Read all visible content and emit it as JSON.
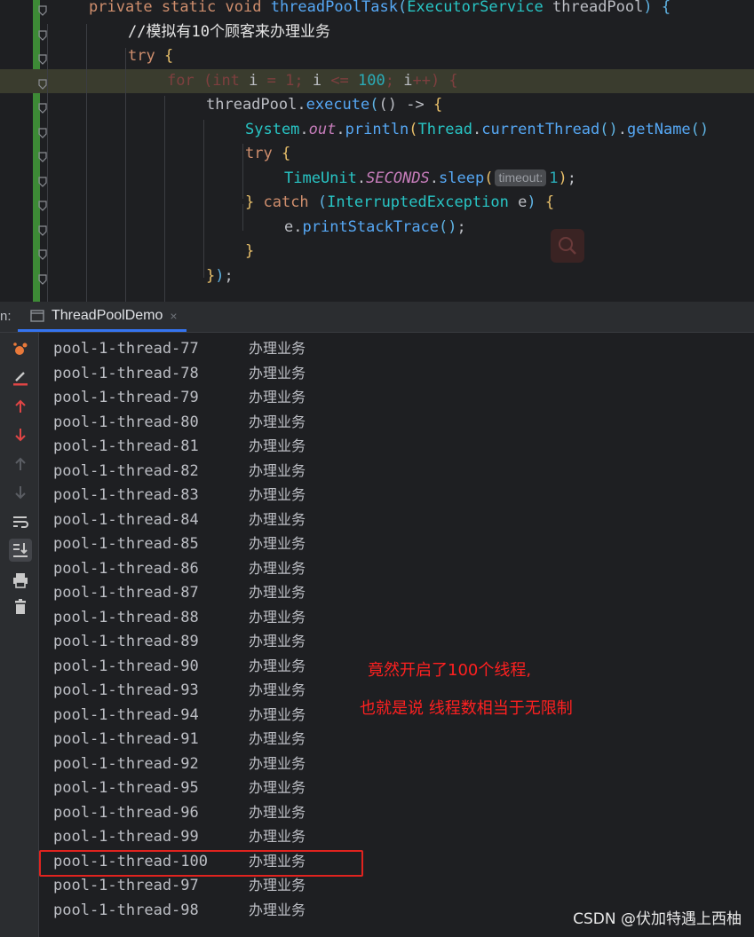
{
  "editor": {
    "lines": [
      {
        "parts": [
          [
            "kw",
            "private static void "
          ],
          [
            "fn",
            "threadPoolTask"
          ],
          [
            "paren2",
            "("
          ],
          [
            "cls",
            "ExecutorService "
          ],
          [
            "pm",
            "threadPool"
          ],
          [
            "paren2",
            ")"
          ],
          [
            "pm",
            " "
          ],
          [
            "paren2",
            "{"
          ]
        ]
      },
      {
        "parts": [
          [
            "cmt",
            "//模拟有10个顾客来办理业务"
          ]
        ]
      },
      {
        "parts": [
          [
            "kw",
            "try "
          ],
          [
            "paren1",
            "{"
          ]
        ]
      },
      {
        "parts": [
          [
            "hidden-kw",
            "for "
          ],
          [
            "hidden-kw",
            "("
          ],
          [
            "hidden-kw",
            "int "
          ],
          [
            "pm",
            "i"
          ],
          [
            "hidden-kw",
            " = 1; "
          ],
          [
            "pm",
            "i"
          ],
          [
            "hidden-kw",
            " <= "
          ],
          [
            "num",
            "100"
          ],
          [
            "hidden-kw",
            "; "
          ],
          [
            "pm",
            "i"
          ],
          [
            "hidden-kw",
            "++) {"
          ]
        ]
      },
      {
        "parts": [
          [
            "pm",
            "threadPool"
          ],
          [
            "pm",
            "."
          ],
          [
            "fn",
            "execute"
          ],
          [
            "paren2",
            "("
          ],
          [
            "pm",
            "() -> "
          ],
          [
            "paren1",
            "{"
          ]
        ]
      },
      {
        "parts": [
          [
            "cls",
            "System"
          ],
          [
            "pm",
            "."
          ],
          [
            "stat",
            "out"
          ],
          [
            "pm",
            "."
          ],
          [
            "fn",
            "println"
          ],
          [
            "paren1",
            "("
          ],
          [
            "cls",
            "Thread"
          ],
          [
            "pm",
            "."
          ],
          [
            "fn",
            "currentThread"
          ],
          [
            "paren2",
            "()"
          ],
          [
            "pm",
            "."
          ],
          [
            "fn",
            "getName"
          ],
          [
            "paren2",
            "()"
          ]
        ]
      },
      {
        "parts": [
          [
            "kw",
            "try "
          ],
          [
            "paren1",
            "{"
          ]
        ]
      },
      {
        "parts": [
          [
            "cls",
            "TimeUnit"
          ],
          [
            "pm",
            "."
          ],
          [
            "stat",
            "SECONDS"
          ],
          [
            "pm",
            "."
          ],
          [
            "fn",
            "sleep"
          ],
          [
            "paren1",
            "("
          ],
          [
            "hint",
            "timeout:"
          ],
          [
            "num",
            "1"
          ],
          [
            "paren1",
            ")"
          ],
          [
            "pm",
            ";"
          ]
        ]
      },
      {
        "parts": [
          [
            "paren1",
            "} "
          ],
          [
            "kw",
            "catch "
          ],
          [
            "paren2",
            "("
          ],
          [
            "cls",
            "InterruptedException "
          ],
          [
            "pm",
            "e"
          ],
          [
            "paren2",
            ")"
          ],
          [
            "pm",
            " "
          ],
          [
            "paren1",
            "{"
          ]
        ]
      },
      {
        "parts": [
          [
            "pm",
            "e"
          ],
          [
            "pm",
            "."
          ],
          [
            "fn",
            "printStackTrace"
          ],
          [
            "paren2",
            "()"
          ],
          [
            "pm",
            ";"
          ]
        ]
      },
      {
        "parts": [
          [
            "paren1",
            "}"
          ]
        ]
      },
      {
        "parts": [
          [
            "paren1",
            "}"
          ],
          [
            "paren2",
            ")"
          ],
          [
            "pm",
            ";"
          ]
        ]
      }
    ]
  },
  "run_panel": {
    "label": "n:",
    "tab_title": "ThreadPoolDemo",
    "tab_close": "×"
  },
  "toolbar_icons": [
    "rerun-icon",
    "edit-config-icon",
    "up-arrow-icon",
    "down-arrow-icon",
    "up-arrow-disabled-icon",
    "down-arrow-disabled-icon",
    "soft-wrap-icon",
    "scroll-to-end-icon",
    "print-icon",
    "trash-icon"
  ],
  "console": {
    "lines": [
      {
        "thread": "pool-1-thread-77",
        "msg": "办理业务"
      },
      {
        "thread": "pool-1-thread-78",
        "msg": "办理业务"
      },
      {
        "thread": "pool-1-thread-79",
        "msg": "办理业务"
      },
      {
        "thread": "pool-1-thread-80",
        "msg": "办理业务"
      },
      {
        "thread": "pool-1-thread-81",
        "msg": "办理业务"
      },
      {
        "thread": "pool-1-thread-82",
        "msg": "办理业务"
      },
      {
        "thread": "pool-1-thread-83",
        "msg": "办理业务"
      },
      {
        "thread": "pool-1-thread-84",
        "msg": "办理业务"
      },
      {
        "thread": "pool-1-thread-85",
        "msg": "办理业务"
      },
      {
        "thread": "pool-1-thread-86",
        "msg": "办理业务"
      },
      {
        "thread": "pool-1-thread-87",
        "msg": "办理业务"
      },
      {
        "thread": "pool-1-thread-88",
        "msg": "办理业务"
      },
      {
        "thread": "pool-1-thread-89",
        "msg": "办理业务"
      },
      {
        "thread": "pool-1-thread-90",
        "msg": "办理业务"
      },
      {
        "thread": "pool-1-thread-93",
        "msg": "办理业务"
      },
      {
        "thread": "pool-1-thread-94",
        "msg": "办理业务"
      },
      {
        "thread": "pool-1-thread-91",
        "msg": "办理业务"
      },
      {
        "thread": "pool-1-thread-92",
        "msg": "办理业务"
      },
      {
        "thread": "pool-1-thread-95",
        "msg": "办理业务"
      },
      {
        "thread": "pool-1-thread-96",
        "msg": "办理业务"
      },
      {
        "thread": "pool-1-thread-99",
        "msg": "办理业务"
      },
      {
        "thread": "pool-1-thread-100",
        "msg": "办理业务"
      },
      {
        "thread": "pool-1-thread-97",
        "msg": "办理业务"
      },
      {
        "thread": "pool-1-thread-98",
        "msg": "办理业务"
      }
    ],
    "highlighted_line": "pool-1-thread-100"
  },
  "annotations": {
    "line1": "竟然开启了100个线程,",
    "line2": "也就是说 线程数相当于无限制",
    "color": "#ff2020"
  },
  "watermark": "CSDN @伏加特遇上西柚"
}
